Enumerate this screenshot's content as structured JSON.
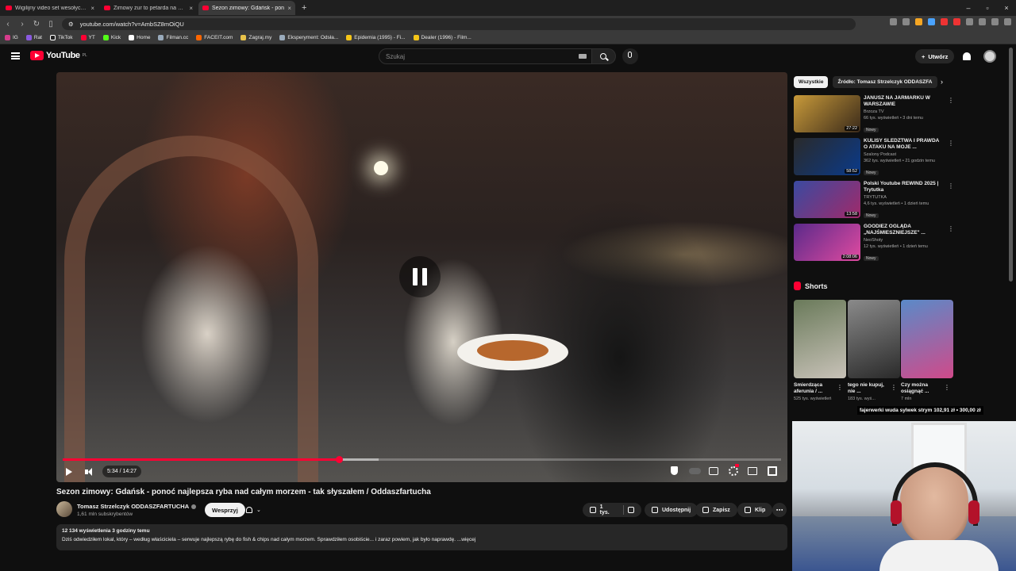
{
  "browser": {
    "tabs": [
      {
        "title": "Wigilijny video set wesołych świąt ko",
        "active": false
      },
      {
        "title": "Zimowy żur to petarda na każdy dzie",
        "active": false
      },
      {
        "title": "Sezon zimowy: Gdańsk - pon",
        "active": true
      }
    ],
    "url": "youtube.com/watch?v=AmbSZ8mOiQU",
    "bookmarks": [
      "IG",
      "Rat",
      "TikTok",
      "YT",
      "Kick",
      "Home",
      "Filman.cc",
      "FACEIT.com",
      "Zagraj.my",
      "Eksperyment: Odsła...",
      "Epidemia (1995) - Fi...",
      "Dealer (1996) - Film..."
    ]
  },
  "header": {
    "logo": "YouTube",
    "region": "PL",
    "search_placeholder": "Szukaj",
    "create_label": "Utwórz"
  },
  "player": {
    "time": "5:34 / 14:27",
    "played_fraction": 0.385,
    "buffered_fraction": 0.44
  },
  "video": {
    "title": "Sezon zimowy: Gdańsk - ponoć najlepsza ryba nad całym morzem - tak słyszałem / Oddaszfartucha",
    "channel": "Tomasz Strzelczyk ODDASZFARTUCHA",
    "subscribers": "1,61 mln subskrybentów",
    "support_label": "Wesprzyj",
    "likes": "1 tys.",
    "share_label": "Udostępnij",
    "save_label": "Zapisz",
    "clip_label": "Klip",
    "views_date": "12 134 wyświetlenia  3 godziny temu",
    "description": "Dziś odwiedziłem lokal, który – według właściciela – serwuje najlepszą rybę do fish & chips nad całym morzem. Sprawdziłem osobiście... i zaraz powiem, jak było naprawdę. ...więcej"
  },
  "chips": [
    "Wszystkie",
    "Źródło: Tomasz Strzelczyk ODDASZFA"
  ],
  "recommendations": [
    {
      "title": "JANUSZ NA JARMARKU W WARSZAWIE",
      "channel": "Brzoza TV",
      "meta": "66 tys. wyświetleń • 3 dni temu",
      "badge": "Nowy",
      "duration": "27:22",
      "color_a": "#c89a3a",
      "color_b": "#3a2a1a"
    },
    {
      "title": "KULISY ŚLEDZTWA I PRAWDA O ATAKU NA MOJE ...",
      "channel": "Szalony Podcast",
      "meta": "362 tys. wyświetleń • 21 godzin temu",
      "badge": "Nowy",
      "duration": "58:52",
      "color_a": "#2a2a2a",
      "color_b": "#0a3a8a"
    },
    {
      "title": "Polski Youtube REWIND 2025 | Trytutka",
      "channel": "TRYTUTKA",
      "meta": "4,6 tys. wyświetleń • 1 dzień temu",
      "badge": "Nowy",
      "duration": "13:58",
      "color_a": "#3a4aa0",
      "color_b": "#a02a6a"
    },
    {
      "title": "GOODIEZ OGLĄDA „NAJŚMIESZNIEJSZE\" ...",
      "channel": "NeoShoty",
      "meta": "12 tys. wyświetleń • 1 dzień temu",
      "badge": "Nowy",
      "duration": "2:08:06",
      "color_a": "#5a2a8a",
      "color_b": "#e04aa0"
    }
  ],
  "shorts": {
    "heading": "Shorts",
    "items": [
      {
        "title": "Śmierdząca aferunia / ...",
        "views": "525 tys. wyświetleń",
        "color_a": "#6a7a5a",
        "color_b": "#c8c2b8"
      },
      {
        "title": "tego nie kupuj, nie ...",
        "views": "183 tys. wyś...",
        "color_a": "#8a8a8a",
        "color_b": "#2a2a2a"
      },
      {
        "title": "Czy można osiągnąć ...",
        "views": "7 mln",
        "color_a": "#5a8ac8",
        "color_b": "#d04a8a"
      }
    ]
  },
  "ticker": "fajerwerki wuda sylwek strym  102,91 zł  •  300,00 zł",
  "colors": {
    "accent": "#ff0033",
    "bg": "#0f0f0f",
    "pill": "#272727"
  },
  "icons": [
    "hamburger-icon",
    "search-icon",
    "mic-icon",
    "plus-icon",
    "bell-icon",
    "play-icon",
    "volume-icon",
    "pause-icon",
    "settings-icon",
    "fullscreen-icon",
    "like-icon",
    "dislike-icon",
    "share-icon",
    "save-icon",
    "clip-icon",
    "more-icon"
  ]
}
